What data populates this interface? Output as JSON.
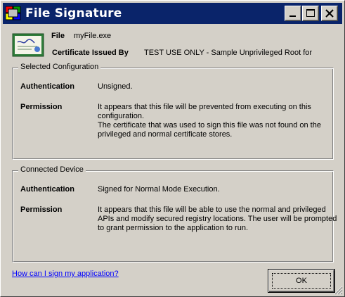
{
  "window": {
    "title": "File Signature",
    "title_bar_color": "#0a246a",
    "controls": [
      "minimize-icon",
      "maximize-icon",
      "close-icon"
    ]
  },
  "file": {
    "label": "File",
    "value": "myFile.exe"
  },
  "certificate": {
    "label": "Certificate Issued By",
    "value": "TEST USE ONLY - Sample Unprivileged Root for"
  },
  "selected_configuration": {
    "title": "Selected Configuration",
    "authentication_label": "Authentication",
    "authentication_value": "Unsigned.",
    "permission_label": "Permission",
    "permission_lines": [
      "It appears that this file will be prevented from executing on this",
      "configuration.",
      "The certificate that was used to sign this file was not found on the",
      "privileged and normal certificate stores."
    ]
  },
  "connected_device": {
    "title": "Connected Device",
    "authentication_label": "Authentication",
    "authentication_value": "Signed for Normal Mode Execution.",
    "permission_label": "Permission",
    "permission_lines": [
      "It appears that this file will be able to use the normal and privileged",
      "APIs and modify secured registry locations. The user will be prompted",
      "to grant permission to the application to run."
    ]
  },
  "footer": {
    "help_link": "How can I sign my application?",
    "ok_label": "OK",
    "link_color": "#0000ff"
  }
}
